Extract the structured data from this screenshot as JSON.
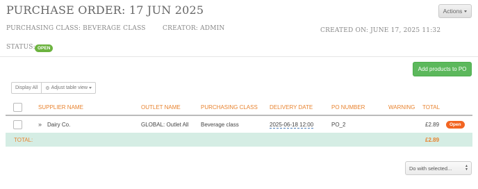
{
  "header": {
    "title": "PURCHASE ORDER: 17 JUN 2025",
    "actions_label": "Actions",
    "purchasing_class": "PURCHASING CLASS: BEVERAGE CLASS",
    "creator": "CREATOR: ADMIN",
    "created_on": "CREATED ON: JUNE 17, 2025 11:32",
    "status_label": "STATUS:",
    "status_value": "OPEN"
  },
  "toolbar": {
    "add_products_label": "Add products to PO",
    "display_all_label": "Display All",
    "adjust_view_label": "Adjust table view"
  },
  "table": {
    "columns": [
      "SUPPLIER NAME",
      "OUTLET NAME",
      "PURCHASING CLASS",
      "DELIVERY DATE",
      "PO NUMBER",
      "WARNING",
      "TOTAL"
    ],
    "rows": [
      {
        "supplier": "Dairy Co.",
        "outlet": "GLOBAL: Outlet All",
        "purchasing_class": "Beverage class",
        "delivery_date": "2025-06-18 12:00",
        "po_number": "PO_2",
        "warning": "",
        "total": "£2.89",
        "status": "Open"
      }
    ],
    "totals": {
      "label": "TOTAL:",
      "amount": "£2.89"
    }
  },
  "footer": {
    "bulk_action_label": "Do with selected..."
  },
  "colors": {
    "accent_orange": "#e8832f",
    "green": "#5cb85c",
    "status_open_green": "#6cb33f",
    "status_open_orange": "#f26522",
    "total_row_bg": "#d5ede4"
  },
  "icons": [
    "caret-down-icon",
    "gear-icon",
    "expand-chevron-icon",
    "select-arrows-icon"
  ]
}
